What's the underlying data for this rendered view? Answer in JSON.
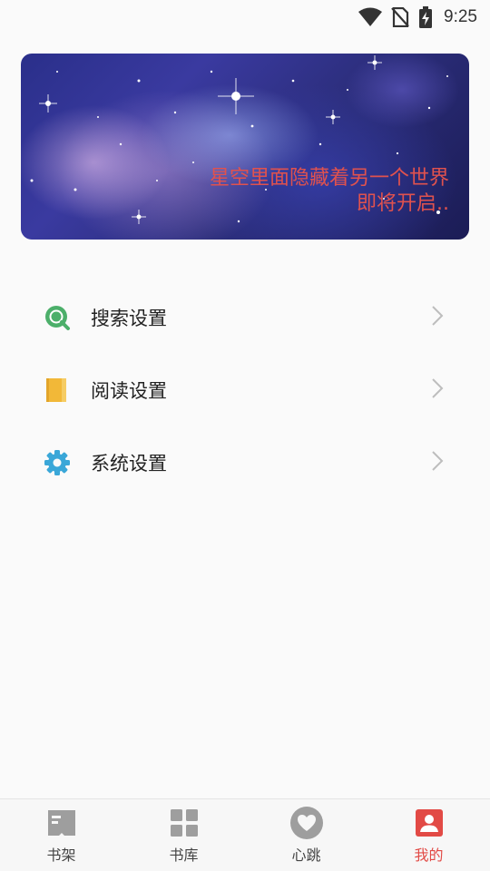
{
  "status_bar": {
    "time": "9:25",
    "icons": [
      "wifi-icon",
      "no-sim-icon",
      "battery-charging-icon"
    ]
  },
  "banner": {
    "line1": "星空里面隐藏着另一个世界",
    "line2": "即将开启..",
    "text_color": "#e0524e"
  },
  "menu": {
    "items": [
      {
        "label": "搜索设置",
        "icon": "search-icon",
        "color": "#4caf6a"
      },
      {
        "label": "阅读设置",
        "icon": "book-icon",
        "color": "#f2b838"
      },
      {
        "label": "系统设置",
        "icon": "gear-icon",
        "color": "#3aa7d8"
      }
    ]
  },
  "bottom_nav": {
    "items": [
      {
        "label": "书架",
        "icon": "bookshelf-icon",
        "active": false
      },
      {
        "label": "书库",
        "icon": "grid-icon",
        "active": false
      },
      {
        "label": "心跳",
        "icon": "heart-icon",
        "active": false
      },
      {
        "label": "我的",
        "icon": "profile-icon",
        "active": true
      }
    ],
    "active_color": "#e24a45",
    "inactive_color": "#9e9e9e"
  }
}
